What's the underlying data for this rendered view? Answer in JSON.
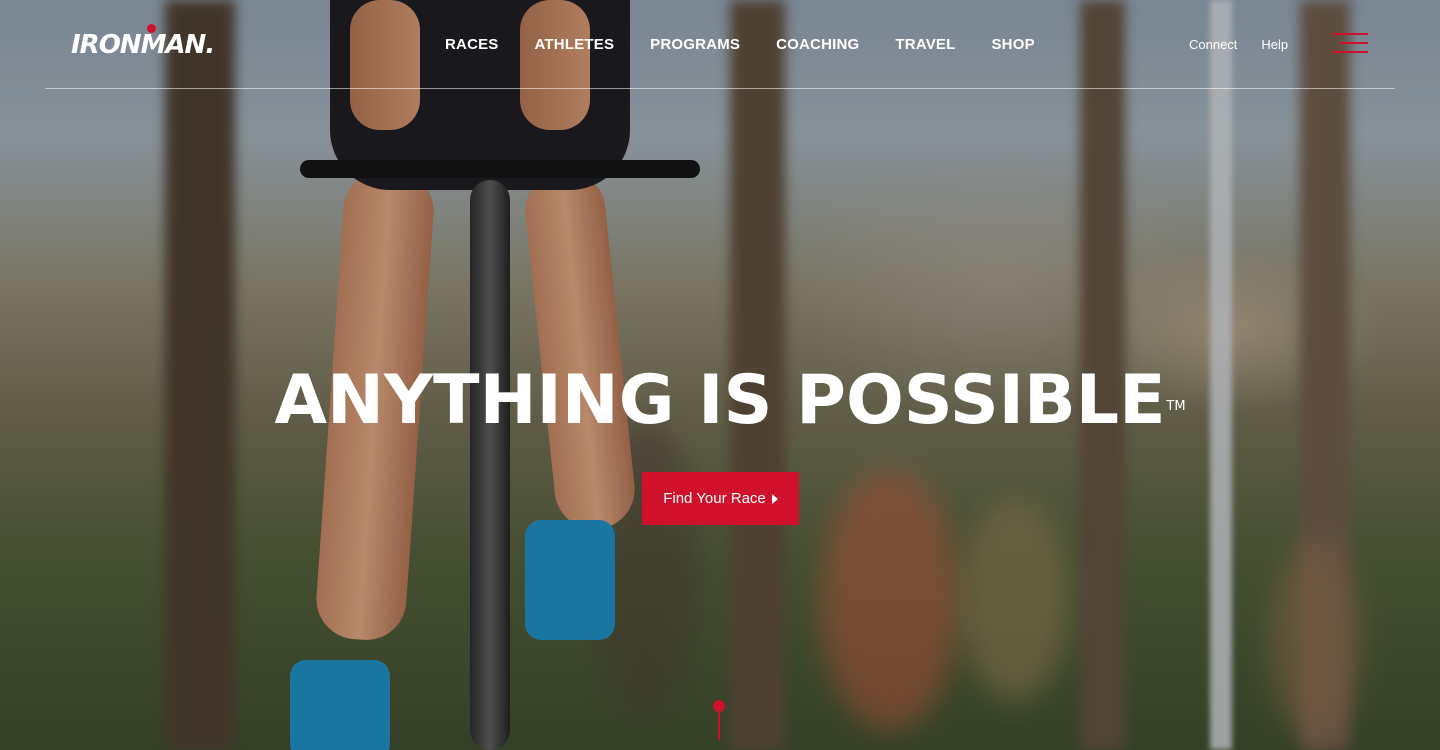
{
  "brand": {
    "logo_text_1": "IRON",
    "logo_text_2": "MAN",
    "logo_text_3": "."
  },
  "nav": {
    "items": [
      "RACES",
      "ATHLETES",
      "PROGRAMS",
      "COACHING",
      "TRAVEL",
      "SHOP"
    ]
  },
  "utility": {
    "connect": "Connect",
    "help": "Help"
  },
  "hero": {
    "headline": "ANYTHING IS POSSIBLE",
    "trademark": "TM",
    "cta_label": "Find Your Race"
  },
  "colors": {
    "brand_red": "#d0112b",
    "text": "#ffffff"
  },
  "icons": {
    "menu": "hamburger-menu-icon",
    "cta_arrow": "triangle-right-icon",
    "scroll": "scroll-pin-icon"
  }
}
